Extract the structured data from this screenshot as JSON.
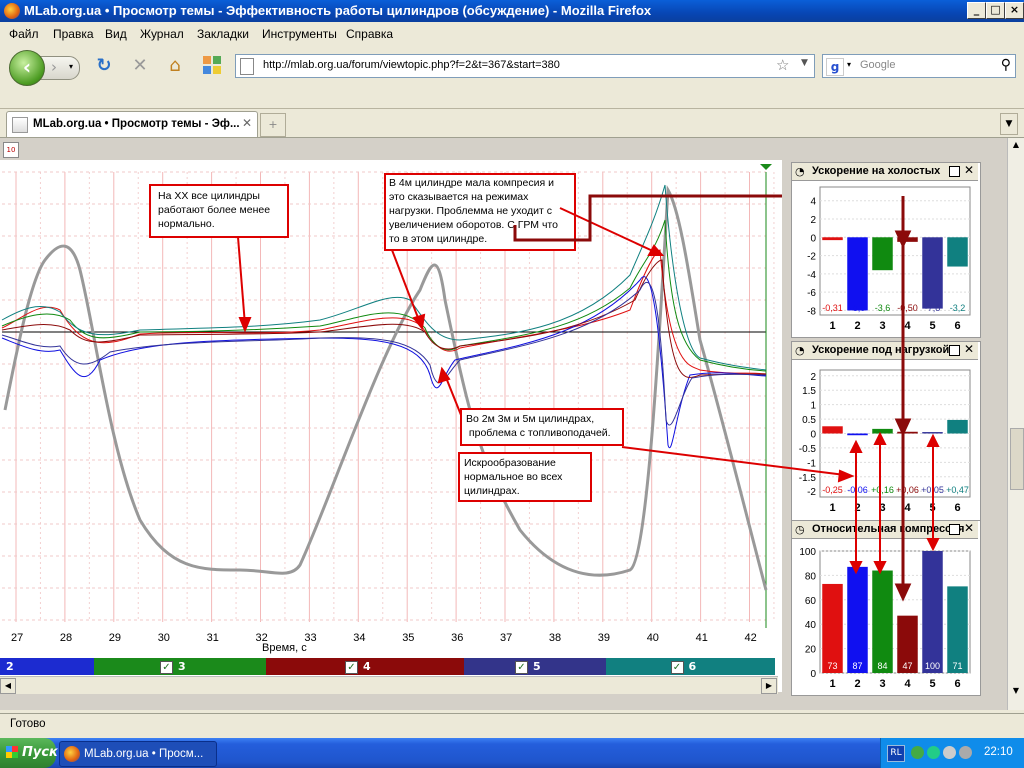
{
  "window": {
    "title": "MLab.org.ua • Просмотр темы - Эффективность работы цилиндров (обсуждение) - Mozilla Firefox"
  },
  "menu": [
    "Файл",
    "Правка",
    "Вид",
    "Журнал",
    "Закладки",
    "Инструменты",
    "Справка"
  ],
  "nav": {
    "url": "http://mlab.org.ua/forum/viewtopic.php?f=2&t=367&start=380",
    "search_placeholder": "Google"
  },
  "tab": {
    "label": "MLab.org.ua • Просмотр темы - Эф...",
    "small_icon_label": "10"
  },
  "main_chart": {
    "xlabel": "Время, с",
    "x_ticks": [
      "27",
      "28",
      "29",
      "30",
      "31",
      "32",
      "33",
      "34",
      "35",
      "36",
      "37",
      "38",
      "39",
      "40",
      "41",
      "42"
    ],
    "channels": [
      {
        "num": "2",
        "color": "#1c2bd0",
        "checked": false
      },
      {
        "num": "3",
        "color": "#1b8a1b",
        "checked": true
      },
      {
        "num": "4",
        "color": "#8b0a0a",
        "checked": true
      },
      {
        "num": "5",
        "color": "#33348a",
        "checked": true
      },
      {
        "num": "6",
        "color": "#118080",
        "checked": true
      }
    ],
    "annotations": [
      "На ХХ все цилиндры работают  более менее нормально.",
      " В 4м цилиндре мала компресия и это сказывается на режимах нагрузки. Проблемма не уходит с увеличением оборотов. С ГРМ что то в этом цилиндре.",
      "Во 2м 3м и 5м цилиндрах, проблема с топливоподачей.",
      "Искрообразование нормальное во всех цилиндрах."
    ]
  },
  "chart_data": [
    {
      "type": "bar",
      "title": "Ускорение на холостых",
      "categories": [
        "1",
        "2",
        "3",
        "4",
        "5",
        "6"
      ],
      "values": [
        -0.31,
        -8.0,
        -3.6,
        -0.5,
        -7.8,
        -3.2
      ],
      "value_labels": [
        "-0,31",
        "-8,0",
        "-3,6",
        "-0,50",
        "-7,8",
        "-3,2"
      ],
      "y_ticks": [
        "4",
        "2",
        "0",
        "-2",
        "-4",
        "-6",
        "-8"
      ],
      "ylim": [
        -8.5,
        5.5
      ],
      "colors": [
        "#e01010",
        "#1010f0",
        "#108a10",
        "#8b0a0a",
        "#333399",
        "#108080"
      ]
    },
    {
      "type": "bar",
      "title": "Ускорение под нагрузкой",
      "categories": [
        "1",
        "2",
        "3",
        "4",
        "5",
        "6"
      ],
      "values": [
        0.25,
        -0.06,
        0.16,
        0.06,
        0.05,
        0.47
      ],
      "value_labels": [
        "-0,25",
        "-0,06",
        "+0,16",
        "+0,06",
        "+0,05",
        "+0,47"
      ],
      "y_ticks": [
        "2",
        "1.5",
        "1",
        "0.5",
        "0",
        "-0.5",
        "-1",
        "-1.5",
        "-2"
      ],
      "ylim": [
        -2.2,
        2.2
      ],
      "colors": [
        "#e01010",
        "#1010f0",
        "#108a10",
        "#8b0a0a",
        "#333399",
        "#108080"
      ]
    },
    {
      "type": "bar",
      "title": "Относительная компрессия",
      "categories": [
        "1",
        "2",
        "3",
        "4",
        "5",
        "6"
      ],
      "values": [
        73,
        87,
        84,
        47,
        100,
        71
      ],
      "value_labels": [
        "73",
        "87",
        "84",
        "47",
        "100",
        "71"
      ],
      "y_ticks": [
        "100",
        "80",
        "60",
        "40",
        "20",
        "0"
      ],
      "ylim": [
        0,
        100
      ],
      "colors": [
        "#e01010",
        "#1010f0",
        "#108a10",
        "#8b0a0a",
        "#333399",
        "#108080"
      ]
    }
  ],
  "status": {
    "text": "Готово"
  },
  "taskbar": {
    "start": "Пуск",
    "item": "MLab.org.ua • Просм...",
    "lang": "RL",
    "time": "22:10"
  }
}
